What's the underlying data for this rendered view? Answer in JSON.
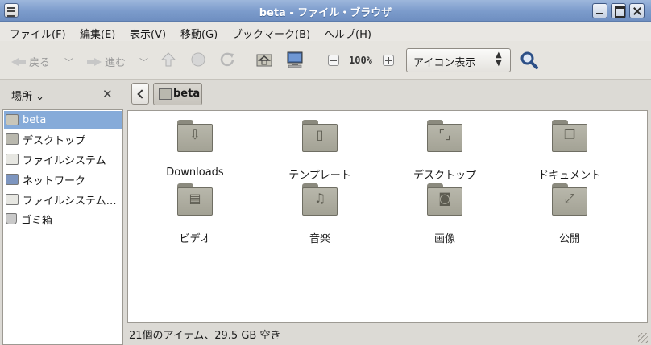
{
  "window": {
    "title": "beta - ファイル・ブラウザ"
  },
  "menubar": [
    "ファイル(F)",
    "編集(E)",
    "表示(V)",
    "移動(G)",
    "ブックマーク(B)",
    "ヘルプ(H)"
  ],
  "toolbar": {
    "back_label": "戻る",
    "forward_label": "進む",
    "zoom_value": "100%",
    "view_mode": "アイコン表示"
  },
  "sidebar": {
    "header": "場所",
    "items": [
      "beta",
      "デスクトップ",
      "ファイルシステム",
      "ネットワーク",
      "ファイルシステム…",
      "ゴミ箱"
    ]
  },
  "pathbar": {
    "current": "beta"
  },
  "content": {
    "items": [
      {
        "name": "Downloads",
        "icon": "download-icon"
      },
      {
        "name": "テンプレート",
        "icon": "template-icon"
      },
      {
        "name": "デスクトップ",
        "icon": "desktop-icon"
      },
      {
        "name": "ドキュメント",
        "icon": "documents-icon"
      },
      {
        "name": "ビデオ",
        "icon": "video-icon"
      },
      {
        "name": "音楽",
        "icon": "music-icon"
      },
      {
        "name": "画像",
        "icon": "camera-icon"
      },
      {
        "name": "公開",
        "icon": "share-icon"
      }
    ]
  },
  "status": {
    "text": "21個のアイテム、29.5 GB 空き"
  }
}
